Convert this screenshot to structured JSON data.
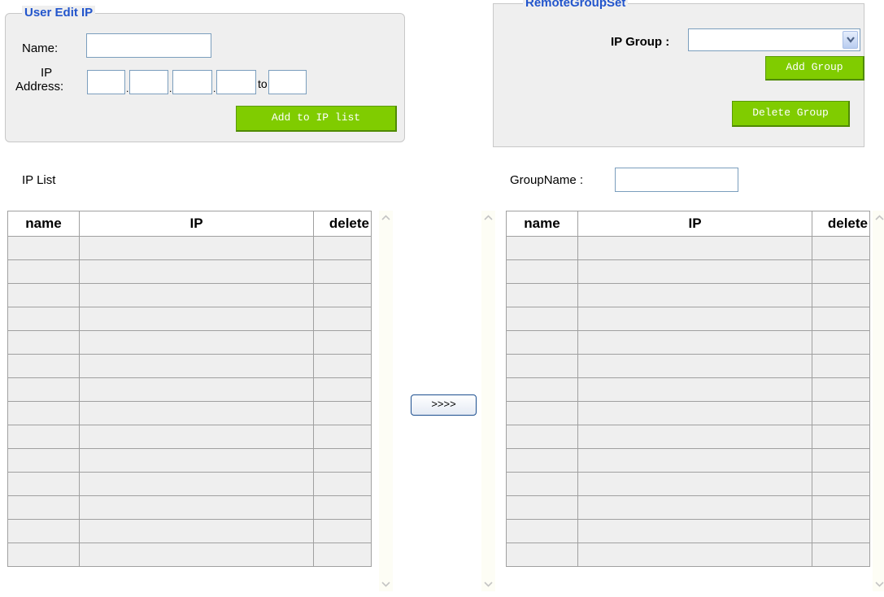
{
  "user_edit": {
    "legend": "User Edit IP",
    "name_label": "Name:",
    "name_value": "",
    "ip_label_line1": "IP",
    "ip_label_line2": "Address:",
    "ip_octets": [
      "",
      "",
      "",
      ""
    ],
    "to_label": "to",
    "ip_end_value": "",
    "add_button": "Add to IP list"
  },
  "remote_group": {
    "legend": "RemoteGroupSet",
    "ip_group_label": "IP Group :",
    "ip_group_selected": "",
    "add_group_button": "Add Group",
    "delete_group_button": "Delete Group"
  },
  "ip_list": {
    "title": "IP List",
    "columns": [
      "name",
      "IP",
      "delete"
    ]
  },
  "group": {
    "name_label": "GroupName :",
    "name_value": "",
    "columns": [
      "name",
      "IP",
      "delete"
    ]
  },
  "move_button": ">>>>",
  "colors": {
    "legend_blue": "#2255cc",
    "button_green": "#80cc00",
    "panel_gray": "#efefef"
  },
  "icons": [
    "chevron-down-icon",
    "scroll-up-icon",
    "scroll-down-icon"
  ]
}
